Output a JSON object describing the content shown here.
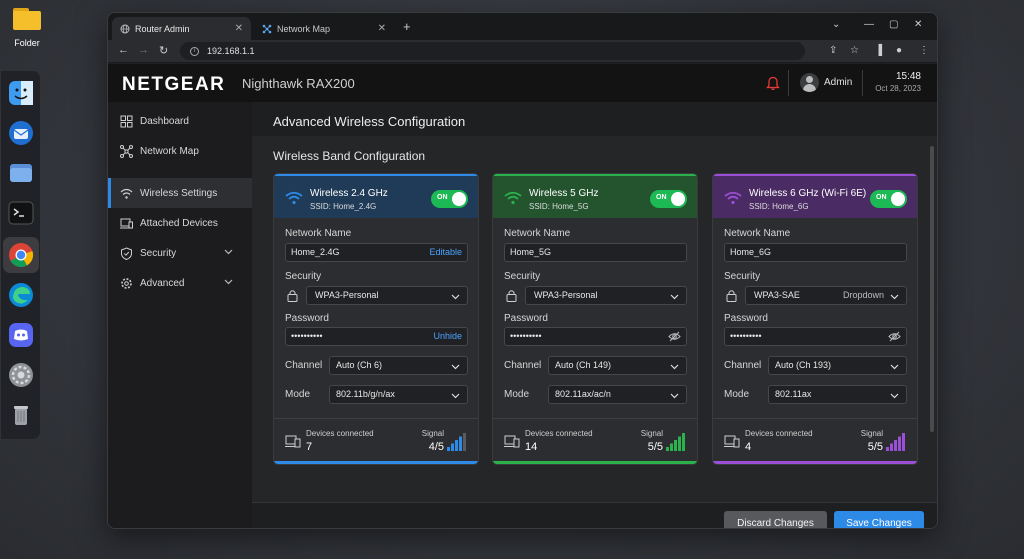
{
  "desktop": {
    "folder_label": "Folder",
    "dock": [
      "finder-icon",
      "thunderbird-icon",
      "files-icon",
      "terminal-icon",
      "chrome-icon",
      "edge-icon",
      "discord-icon",
      "settings-icon",
      "trash-icon"
    ]
  },
  "browser": {
    "tabs": [
      {
        "label": "Router Admin",
        "icon": "globe-icon",
        "active": true
      },
      {
        "label": "Network Map",
        "icon": "network-icon",
        "active": false
      }
    ],
    "new_tab": "+",
    "url": "192.168.1.1"
  },
  "header": {
    "brand": "NETGEAR",
    "model": "Nighthawk RAX200",
    "user": "Admin",
    "time": "15:48",
    "date": "Oct 28, 2023",
    "alert_color": "#e53935"
  },
  "sidebar": {
    "items": [
      {
        "label": "Dashboard",
        "icon": "dashboard-icon"
      },
      {
        "label": "Network Map",
        "icon": "network-map-icon"
      },
      {
        "label": "Wireless Settings",
        "icon": "wifi-icon",
        "active": true
      },
      {
        "label": "Attached Devices",
        "icon": "devices-icon"
      },
      {
        "label": "Security",
        "icon": "shield-icon",
        "expandable": true
      },
      {
        "label": "Advanced",
        "icon": "gear-icon",
        "expandable": true
      }
    ]
  },
  "main": {
    "title": "Advanced Wireless Configuration",
    "section": "Wireless Band Configuration",
    "labels": {
      "network_name": "Network Name",
      "security": "Security",
      "password": "Password",
      "channel": "Channel",
      "mode": "Mode",
      "devices_connected": "Devices connected",
      "signal": "Signal"
    },
    "cards": [
      {
        "band": "Wireless 2.4 GHz",
        "ssid": "SSID: Home_2.4G",
        "toggle": "ON",
        "accent": "#2d8ae6",
        "head_bg": "#1f3b57",
        "network_name": "Home_2.4G",
        "name_aux": "Editable",
        "security": "WPA3-Personal",
        "security_aux": "",
        "password": "••••••••••",
        "password_aux": "Unhide",
        "channel": "Auto (Ch 6)",
        "mode": "802.11b/g/n/ax",
        "devices": "7",
        "signal": "4/5",
        "signal_level": 4
      },
      {
        "band": "Wireless 5 GHz",
        "ssid": "SSID: Home_5G",
        "toggle": "ON",
        "accent": "#2bb24c",
        "head_bg": "#23542e",
        "network_name": "Home_5G",
        "name_aux": "",
        "security": "WPA3-Personal",
        "security_aux": "",
        "password": "••••••••••",
        "password_aux": "",
        "channel": "Auto (Ch 149)",
        "mode": "802.11ax/ac/n",
        "devices": "14",
        "signal": "5/5",
        "signal_level": 5
      },
      {
        "band": "Wireless 6 GHz (Wi-Fi 6E)",
        "ssid": "SSID: Home_6G",
        "toggle": "ON",
        "accent": "#9b4fd6",
        "head_bg": "#4a2b63",
        "network_name": "Home_6G",
        "name_aux": "",
        "security": "WPA3-SAE",
        "security_aux": "Dropdown",
        "password": "••••••••••",
        "password_aux": "",
        "channel": "Auto (Ch 193)",
        "mode": "802.11ax",
        "devices": "4",
        "signal": "5/5",
        "signal_level": 5
      }
    ],
    "buttons": {
      "discard": "Discard Changes",
      "save": "Save Changes"
    }
  }
}
